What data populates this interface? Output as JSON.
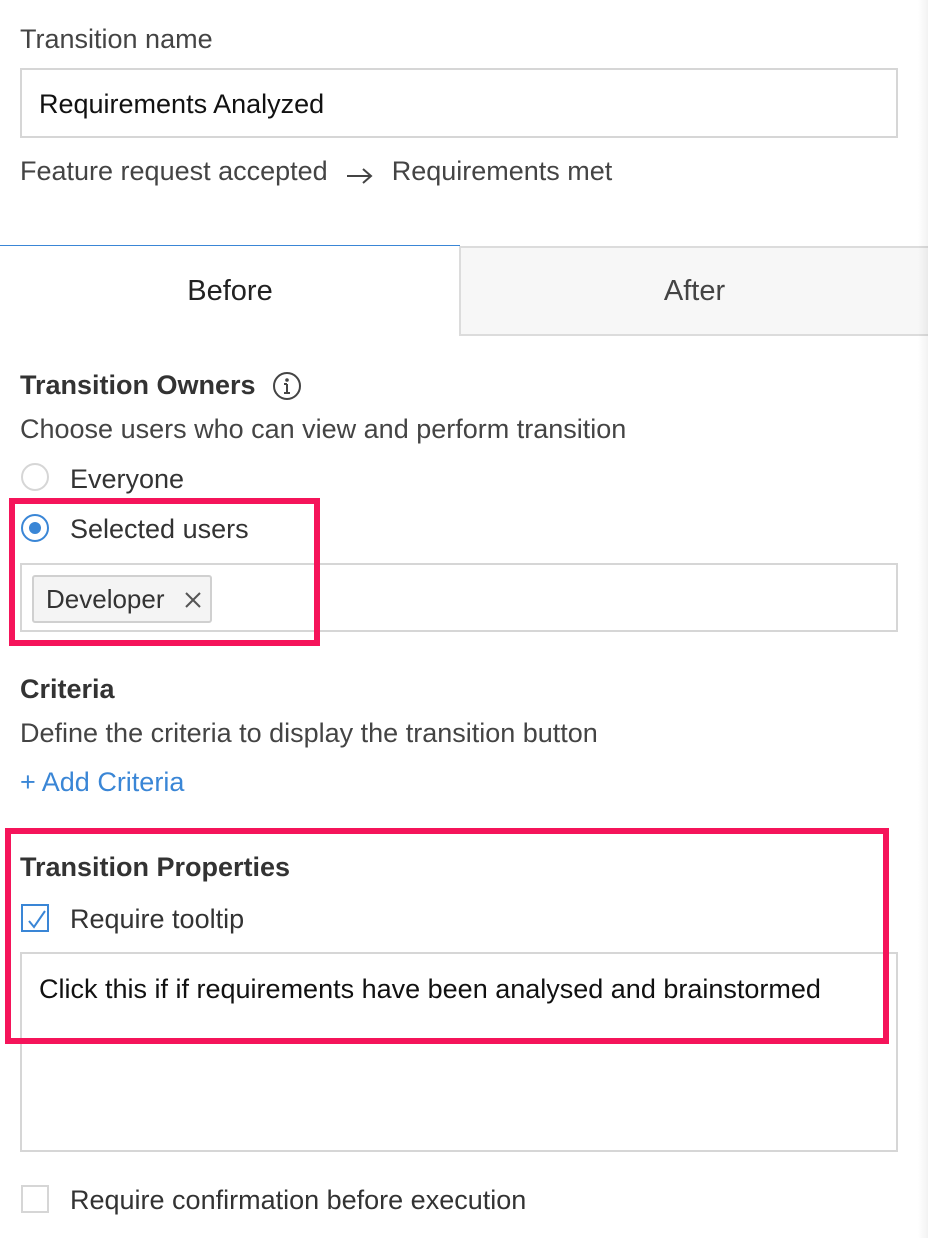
{
  "transition_name": {
    "label": "Transition name",
    "value": "Requirements Analyzed"
  },
  "flow": {
    "from": "Feature request accepted",
    "to": "Requirements met"
  },
  "tabs": [
    {
      "label": "Before",
      "active": true
    },
    {
      "label": "After",
      "active": false
    }
  ],
  "owners": {
    "title": "Transition Owners",
    "description": "Choose users who can view and perform transition",
    "options": [
      {
        "label": "Everyone",
        "selected": false
      },
      {
        "label": "Selected users",
        "selected": true
      }
    ],
    "chips": [
      {
        "label": "Developer"
      }
    ]
  },
  "criteria": {
    "title": "Criteria",
    "description": "Define the criteria to display the transition button",
    "add_link": "+ Add Criteria"
  },
  "properties": {
    "title": "Transition Properties",
    "require_tooltip": {
      "label": "Require tooltip",
      "checked": true
    },
    "tooltip_text": "Click this if if requirements have been analysed and brainstormed",
    "require_confirmation": {
      "label": "Require confirmation before execution",
      "checked": false
    }
  },
  "colors": {
    "accent": "#3a86d6",
    "highlight": "#f5145a",
    "border": "#d6d6d6"
  }
}
